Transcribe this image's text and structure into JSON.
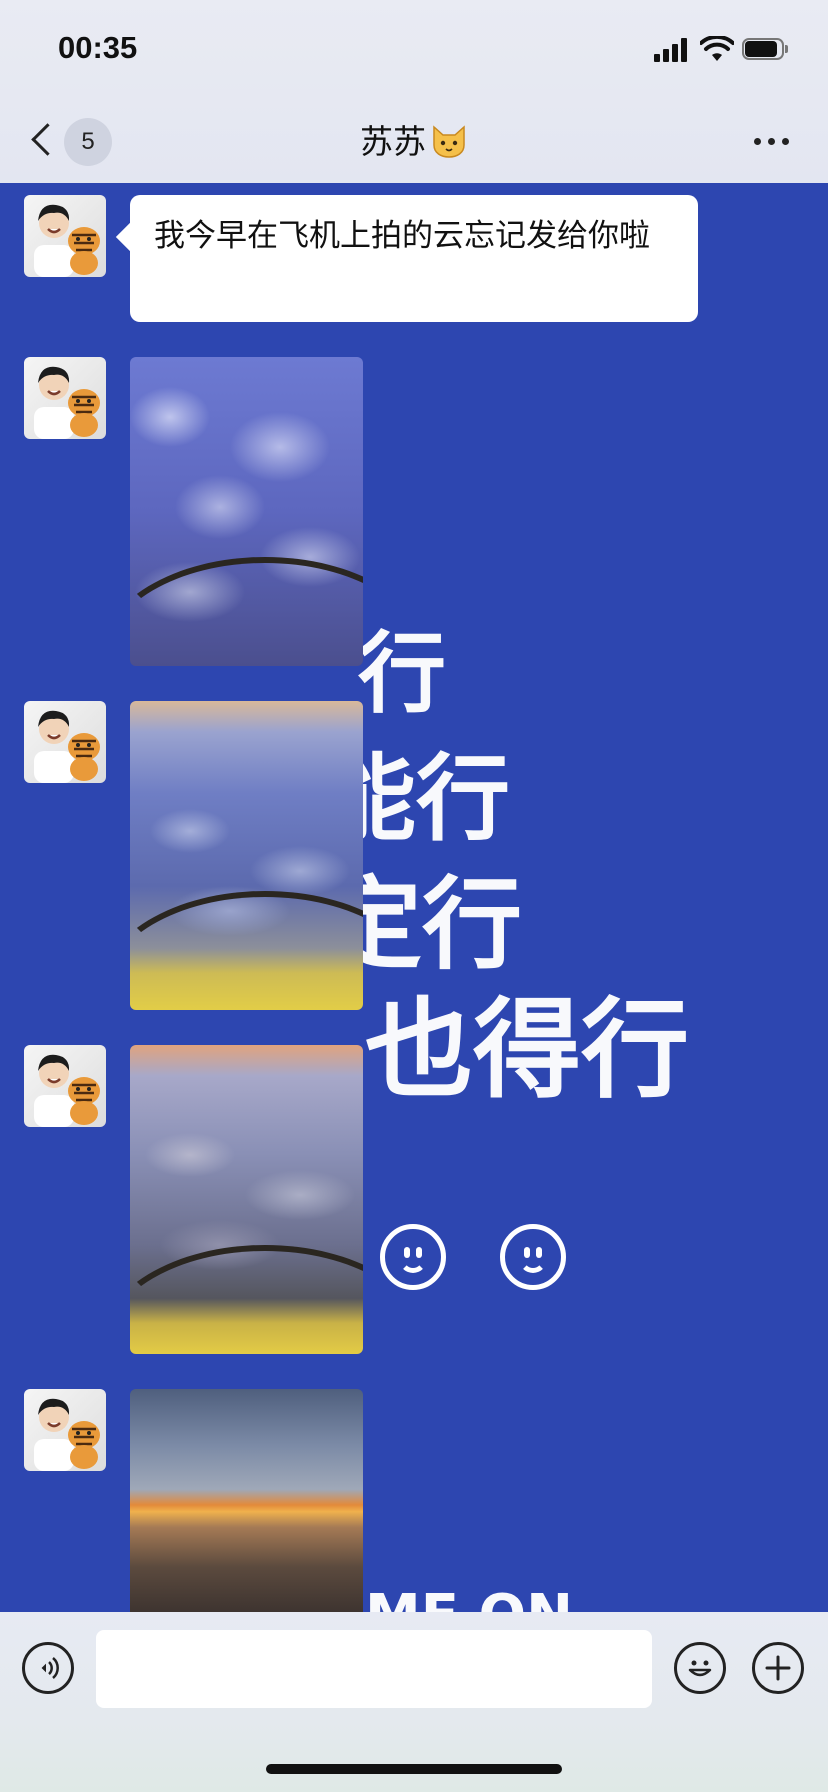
{
  "status_bar": {
    "time": "00:35",
    "battery_level": 0.9,
    "icons": [
      "cellular-signal-icon",
      "wifi-icon",
      "battery-icon"
    ]
  },
  "header": {
    "unread_count": "5",
    "title": "苏苏",
    "title_emoji_icon": "cat-face-icon",
    "back_icon": "chevron-left-icon",
    "more_icon": "more-dots-icon"
  },
  "wallpaper": {
    "lines": [
      "行",
      "能行",
      "定行",
      "也得行",
      "ME ON"
    ],
    "smiley_icons": [
      "smiley-icon",
      "smiley-icon"
    ],
    "color": "#2d46b0"
  },
  "messages": [
    {
      "type": "text",
      "sender": "苏苏",
      "text": "我今早在飞机上拍的云忘记发给你啦"
    },
    {
      "type": "image",
      "sender": "苏苏",
      "subject": "clouds-from-airplane-window"
    },
    {
      "type": "image",
      "sender": "苏苏",
      "subject": "clouds-from-airplane-window"
    },
    {
      "type": "image",
      "sender": "苏苏",
      "subject": "clouds-from-airplane-window"
    },
    {
      "type": "image",
      "sender": "苏苏",
      "subject": "sunset-horizon-from-airplane-window"
    }
  ],
  "input_bar": {
    "voice_icon": "voice-icon",
    "message_value": "",
    "emoji_icon": "emoji-icon",
    "plus_icon": "plus-icon"
  }
}
